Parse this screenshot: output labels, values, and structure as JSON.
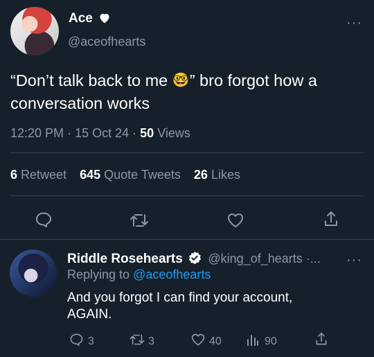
{
  "tweet": {
    "display_name": "Ace",
    "handle": "@aceofhearts",
    "text_part1": "“Don’t talk back to me",
    "text_part2": "” bro forgot how a",
    "text_line2": "conversation works",
    "emoji": "🤓",
    "time": "12:20 PM",
    "sep1": "·",
    "date": "15 Oct 24",
    "sep2": "·",
    "views_count": "50",
    "views_label": "Views"
  },
  "stats": {
    "retweets_count": "6",
    "retweets_label": "Retweet",
    "quotes_count": "645",
    "quotes_label": "Quote Tweets",
    "likes_count": "26",
    "likes_label": "Likes"
  },
  "reply": {
    "display_name": "Riddle Rosehearts",
    "handle": "@king_of_hearts ·...",
    "replying_prefix": "Replying to",
    "replying_handle": "@aceofhearts",
    "text_line1": "And you forgot I can find your account,",
    "text_line2": "AGAIN.",
    "replies": "3",
    "retweets": "3",
    "likes": "40",
    "views": "90"
  },
  "colors": {
    "background": "#15202b",
    "muted": "#8b98a5",
    "link": "#1d9bf0",
    "divider": "#38444d"
  }
}
